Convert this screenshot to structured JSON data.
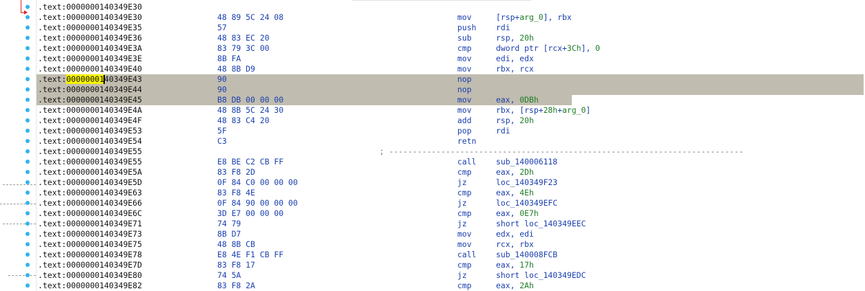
{
  "gutter": {
    "dot_color": "#32b4ea",
    "arrow_color": "#dd2222"
  },
  "listing": {
    "rows": [
      {
        "prefix": ".text:",
        "addr": "0000000140349E30",
        "bytes": "",
        "mnem": "",
        "ops": []
      },
      {
        "prefix": ".text:",
        "addr": "0000000140349E30",
        "bytes": "48 89 5C 24 08",
        "mnem": "mov",
        "ops": [
          {
            "t": "[rsp+"
          },
          {
            "t": "arg_0",
            "k": "sym"
          },
          {
            "t": "], rbx"
          }
        ]
      },
      {
        "prefix": ".text:",
        "addr": "0000000140349E35",
        "bytes": "57",
        "mnem": "push",
        "ops": [
          {
            "t": "rdi"
          }
        ]
      },
      {
        "prefix": ".text:",
        "addr": "0000000140349E36",
        "bytes": "48 83 EC 20",
        "mnem": "sub",
        "ops": [
          {
            "t": "rsp, "
          },
          {
            "t": "20h",
            "k": "num"
          }
        ]
      },
      {
        "prefix": ".text:",
        "addr": "0000000140349E3A",
        "bytes": "83 79 3C 00",
        "mnem": "cmp",
        "ops": [
          {
            "t": "dword ptr [rcx+"
          },
          {
            "t": "3Ch",
            "k": "num"
          },
          {
            "t": "], "
          },
          {
            "t": "0",
            "k": "num"
          }
        ]
      },
      {
        "prefix": ".text:",
        "addr": "0000000140349E3E",
        "bytes": "8B FA",
        "mnem": "mov",
        "ops": [
          {
            "t": "edi, edx"
          }
        ]
      },
      {
        "prefix": ".text:",
        "addr": "0000000140349E40",
        "bytes": "48 8B D9",
        "mnem": "mov",
        "ops": [
          {
            "t": "rbx, rcx"
          }
        ]
      },
      {
        "prefix": ".text:",
        "addr_hl": "00000001",
        "addr_rest": "40349E43",
        "addr": "0000000140349E43",
        "bytes": "90",
        "mnem": "nop",
        "ops": [],
        "selected": true,
        "sel_width": 1199
      },
      {
        "prefix": ".text:",
        "addr": "0000000140349E44",
        "bytes": "90",
        "mnem": "nop",
        "ops": [],
        "selected": true,
        "sel_width": 1199
      },
      {
        "prefix": ".text:",
        "addr": "0000000140349E45",
        "bytes": "B8 DB 00 00 00",
        "mnem": "mov",
        "ops": [
          {
            "t": "eax, "
          },
          {
            "t": "0DBh",
            "k": "num"
          }
        ],
        "selected": true,
        "sel_width": 776
      },
      {
        "prefix": ".text:",
        "addr": "0000000140349E4A",
        "bytes": "48 8B 5C 24 30",
        "mnem": "mov",
        "ops": [
          {
            "t": "rbx, [rsp+"
          },
          {
            "t": "28h",
            "k": "num"
          },
          {
            "t": "+"
          },
          {
            "t": "arg_0",
            "k": "sym"
          },
          {
            "t": "]"
          }
        ]
      },
      {
        "prefix": ".text:",
        "addr": "0000000140349E4F",
        "bytes": "48 83 C4 20",
        "mnem": "add",
        "ops": [
          {
            "t": "rsp, "
          },
          {
            "t": "20h",
            "k": "num"
          }
        ]
      },
      {
        "prefix": ".text:",
        "addr": "0000000140349E53",
        "bytes": "5F",
        "mnem": "pop",
        "ops": [
          {
            "t": "rdi"
          }
        ]
      },
      {
        "prefix": ".text:",
        "addr": "0000000140349E54",
        "bytes": "C3",
        "mnem": "retn",
        "ops": []
      },
      {
        "prefix": ".text:",
        "addr": "0000000140349E55",
        "bytes": "",
        "mnem": "",
        "ops": [],
        "separator": "; ---------------------------------------------------------------------------"
      },
      {
        "prefix": ".text:",
        "addr": "0000000140349E55",
        "bytes": "E8 BE C2 CB FF",
        "mnem": "call",
        "ops": [
          {
            "t": "sub_140006118"
          }
        ]
      },
      {
        "prefix": ".text:",
        "addr": "0000000140349E5A",
        "bytes": "83 F8 2D",
        "mnem": "cmp",
        "ops": [
          {
            "t": "eax, "
          },
          {
            "t": "2Dh",
            "k": "num"
          }
        ]
      },
      {
        "prefix": ".text:",
        "addr": "0000000140349E5D",
        "bytes": "0F 84 C0 00 00 00",
        "mnem": "jz",
        "ops": [
          {
            "t": "loc_140349F23"
          }
        ]
      },
      {
        "prefix": ".text:",
        "addr": "0000000140349E63",
        "bytes": "83 F8 4E",
        "mnem": "cmp",
        "ops": [
          {
            "t": "eax, "
          },
          {
            "t": "4Eh",
            "k": "num"
          }
        ]
      },
      {
        "prefix": ".text:",
        "addr": "0000000140349E66",
        "bytes": "0F 84 90 00 00 00",
        "mnem": "jz",
        "ops": [
          {
            "t": "loc_140349EFC"
          }
        ]
      },
      {
        "prefix": ".text:",
        "addr": "0000000140349E6C",
        "bytes": "3D E7 00 00 00",
        "mnem": "cmp",
        "ops": [
          {
            "t": "eax, "
          },
          {
            "t": "0E7h",
            "k": "num"
          }
        ]
      },
      {
        "prefix": ".text:",
        "addr": "0000000140349E71",
        "bytes": "74 79",
        "mnem": "jz",
        "ops": [
          {
            "t": "short loc_140349EEC"
          }
        ]
      },
      {
        "prefix": ".text:",
        "addr": "0000000140349E73",
        "bytes": "8B D7",
        "mnem": "mov",
        "ops": [
          {
            "t": "edx, edi"
          }
        ]
      },
      {
        "prefix": ".text:",
        "addr": "0000000140349E75",
        "bytes": "48 8B CB",
        "mnem": "mov",
        "ops": [
          {
            "t": "rcx, rbx"
          }
        ]
      },
      {
        "prefix": ".text:",
        "addr": "0000000140349E78",
        "bytes": "E8 4E F1 CB FF",
        "mnem": "call",
        "ops": [
          {
            "t": "sub_140008FCB"
          }
        ]
      },
      {
        "prefix": ".text:",
        "addr": "0000000140349E7D",
        "bytes": "83 F8 17",
        "mnem": "cmp",
        "ops": [
          {
            "t": "eax, "
          },
          {
            "t": "17h",
            "k": "num"
          }
        ]
      },
      {
        "prefix": ".text:",
        "addr": "0000000140349E80",
        "bytes": "74 5A",
        "mnem": "jz",
        "ops": [
          {
            "t": "short loc_140349EDC"
          }
        ]
      },
      {
        "prefix": ".text:",
        "addr": "0000000140349E82",
        "bytes": "83 F8 2A",
        "mnem": "cmp",
        "ops": [
          {
            "t": "eax, "
          },
          {
            "t": "2Ah",
            "k": "num"
          }
        ]
      }
    ]
  }
}
